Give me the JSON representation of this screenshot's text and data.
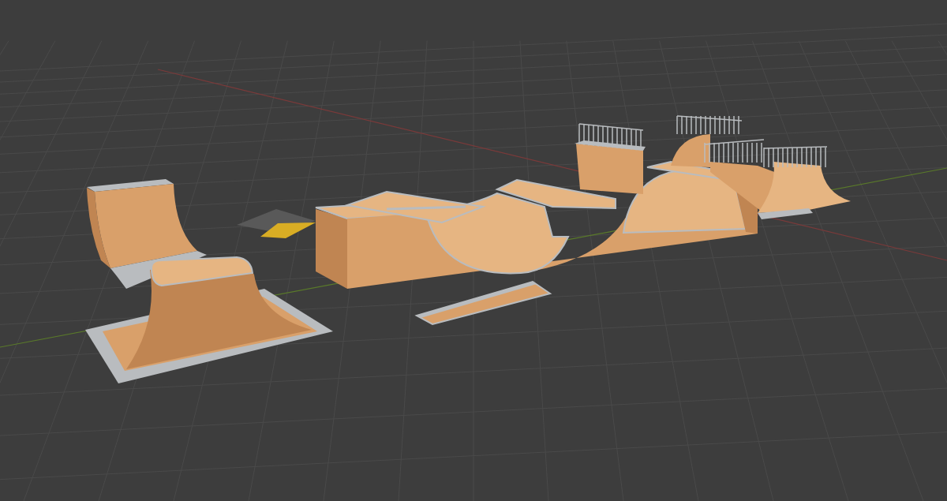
{
  "viewport": {
    "objects": [
      {
        "kind": "quarterpipe"
      },
      {
        "kind": "funbox"
      },
      {
        "kind": "kicker"
      },
      {
        "kind": "halfpipe"
      },
      {
        "kind": "spine"
      },
      {
        "kind": "ledge"
      },
      {
        "kind": "railbox"
      },
      {
        "kind": "miniramp"
      }
    ]
  }
}
